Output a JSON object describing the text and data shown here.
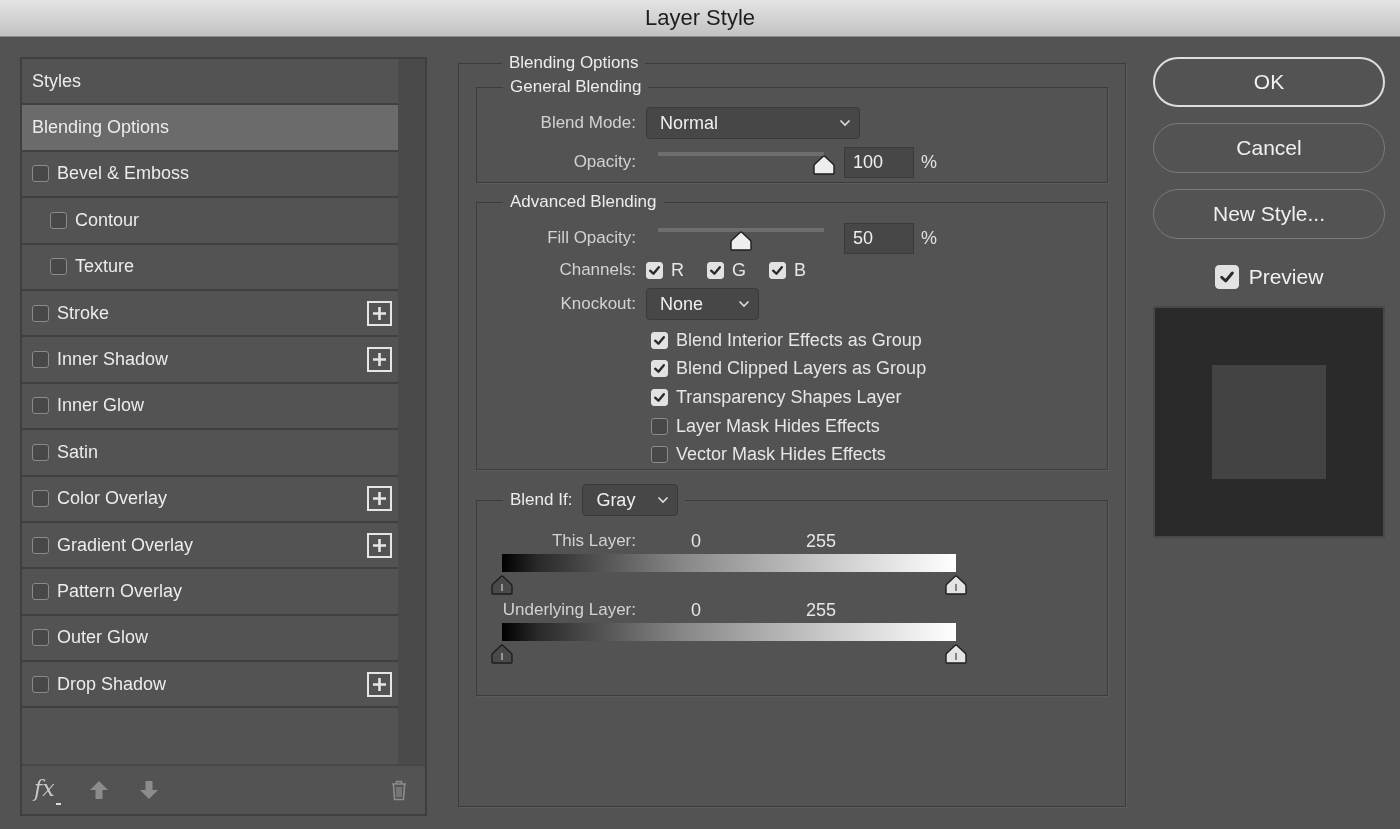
{
  "window": {
    "title": "Layer Style"
  },
  "sidebar": {
    "items": [
      {
        "kind": "page",
        "label": "Styles",
        "selected": false
      },
      {
        "kind": "page",
        "label": "Blending Options",
        "selected": true
      },
      {
        "kind": "effect",
        "label": "Bevel & Emboss",
        "checked": false,
        "add": false,
        "selected": false,
        "children": [
          {
            "kind": "effect",
            "label": "Contour",
            "checked": false,
            "add": false,
            "selected": false
          },
          {
            "kind": "effect",
            "label": "Texture",
            "checked": false,
            "add": false,
            "selected": false
          }
        ]
      },
      {
        "kind": "effect",
        "label": "Stroke",
        "checked": false,
        "add": true,
        "selected": false
      },
      {
        "kind": "effect",
        "label": "Inner Shadow",
        "checked": false,
        "add": true,
        "selected": false
      },
      {
        "kind": "effect",
        "label": "Inner Glow",
        "checked": false,
        "add": false,
        "selected": false
      },
      {
        "kind": "effect",
        "label": "Satin",
        "checked": false,
        "add": false,
        "selected": false
      },
      {
        "kind": "effect",
        "label": "Color Overlay",
        "checked": false,
        "add": true,
        "selected": false
      },
      {
        "kind": "effect",
        "label": "Gradient Overlay",
        "checked": false,
        "add": true,
        "selected": false
      },
      {
        "kind": "effect",
        "label": "Pattern Overlay",
        "checked": false,
        "add": false,
        "selected": false
      },
      {
        "kind": "effect",
        "label": "Outer Glow",
        "checked": false,
        "add": false,
        "selected": false
      },
      {
        "kind": "effect",
        "label": "Drop Shadow",
        "checked": false,
        "add": true,
        "selected": false
      }
    ],
    "footer": {
      "fx": "fx"
    }
  },
  "blending_options": {
    "title": "Blending Options",
    "general": {
      "title": "General Blending",
      "blend_mode": {
        "label": "Blend Mode:",
        "value": "Normal"
      },
      "opacity": {
        "label": "Opacity:",
        "level": 1,
        "value": "100",
        "unit": "%"
      }
    },
    "advanced": {
      "title": "Advanced Blending",
      "fill_opacity": {
        "label": "Fill Opacity:",
        "level": 0.5,
        "value": "50",
        "unit": "%"
      },
      "channels": {
        "label": "Channels:",
        "items": [
          {
            "label": "R",
            "checked": true
          },
          {
            "label": "G",
            "checked": true
          },
          {
            "label": "B",
            "checked": true
          }
        ]
      },
      "knockout": {
        "label": "Knockout:",
        "value": "None"
      },
      "options": [
        {
          "label": "Blend Interior Effects as Group",
          "checked": true
        },
        {
          "label": "Blend Clipped Layers as Group",
          "checked": true
        },
        {
          "label": "Transparency Shapes Layer",
          "checked": true
        },
        {
          "label": "Layer Mask Hides Effects",
          "checked": false
        },
        {
          "label": "Vector Mask Hides Effects",
          "checked": false
        }
      ]
    },
    "blend_if": {
      "label": "Blend If:",
      "value": "Gray",
      "ranges": [
        {
          "label": "This Layer:",
          "low": "0",
          "high": "255"
        },
        {
          "label": "Underlying Layer:",
          "low": "0",
          "high": "255"
        }
      ]
    }
  },
  "buttons": [
    {
      "label": "OK",
      "default": true
    },
    {
      "label": "Cancel",
      "default": false
    },
    {
      "label": "New Style...",
      "default": false
    }
  ],
  "preview": {
    "label": "Preview",
    "checked": true
  }
}
